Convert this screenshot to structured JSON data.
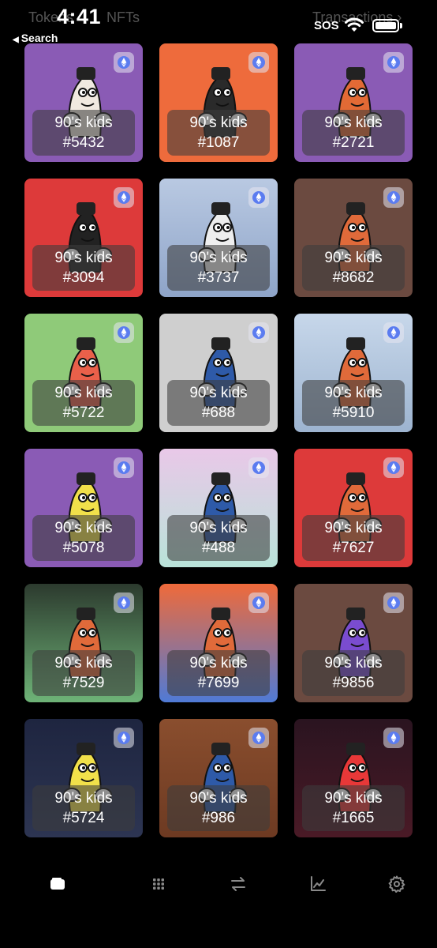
{
  "status_bar": {
    "time": "4:41",
    "back_label": "Search",
    "cellular": "SOS"
  },
  "header": {
    "segments": [
      "Tokens",
      "NFTs"
    ],
    "transactions_label": "Transactions"
  },
  "accent_colors": {
    "purple": "#8b5bb3",
    "orange": "#ee6b3c",
    "red": "#e03c3c",
    "brown": "#6b4a40",
    "green": "#8fca79",
    "gray": "#c9c9c9"
  },
  "nfts": [
    {
      "collection": "90's kids",
      "token": "#5432",
      "bg": "#8a5bb5",
      "bg2": "#8a5bb5",
      "ink": "#f0e9e0",
      "chain_icon": "ethereum-icon"
    },
    {
      "collection": "90's kids",
      "token": "#1087",
      "bg": "#ee6b3c",
      "bg2": "#ee6b3c",
      "ink": "#2a2a2a",
      "chain_icon": "ethereum-icon"
    },
    {
      "collection": "90's kids",
      "token": "#2721",
      "bg": "#8a5bb5",
      "bg2": "#8a5bb5",
      "ink": "#e26a35",
      "chain_icon": "ethereum-icon"
    },
    {
      "collection": "90's kids",
      "token": "#3094",
      "bg": "#dd3a3a",
      "bg2": "#dd3a3a",
      "ink": "#222222",
      "chain_icon": "ethereum-icon"
    },
    {
      "collection": "90's kids",
      "token": "#3737",
      "bg": "#b9c9e2",
      "bg2": "#8ea4c8",
      "ink": "#eeeeee",
      "chain_icon": "ethereum-icon"
    },
    {
      "collection": "90's kids",
      "token": "#8682",
      "bg": "#6b4a40",
      "bg2": "#6b4a40",
      "ink": "#e06a3a",
      "chain_icon": "ethereum-icon"
    },
    {
      "collection": "90's kids",
      "token": "#5722",
      "bg": "#8fca79",
      "bg2": "#8fca79",
      "ink": "#e9604a",
      "chain_icon": "ethereum-icon"
    },
    {
      "collection": "90's kids",
      "token": "#688",
      "bg": "#cfcfcf",
      "bg2": "#cfcfcf",
      "ink": "#2e5aa8",
      "chain_icon": "ethereum-icon"
    },
    {
      "collection": "90's kids",
      "token": "#5910",
      "bg": "#c7d7ea",
      "bg2": "#9db4d0",
      "ink": "#e06a3a",
      "chain_icon": "ethereum-icon"
    },
    {
      "collection": "90's kids",
      "token": "#5078",
      "bg": "#8a5bb5",
      "bg2": "#8a5bb5",
      "ink": "#f1e04a",
      "chain_icon": "ethereum-icon"
    },
    {
      "collection": "90's kids",
      "token": "#488",
      "bg": "#e9c8e8",
      "bg2": "#b9e3d9",
      "ink": "#2e5aa8",
      "chain_icon": "ethereum-icon"
    },
    {
      "collection": "90's kids",
      "token": "#7627",
      "bg": "#dd3a3a",
      "bg2": "#dd3a3a",
      "ink": "#e06a3a",
      "chain_icon": "ethereum-icon"
    },
    {
      "collection": "90's kids",
      "token": "#7529",
      "bg": "#2c3a2e",
      "bg2": "#6eb377",
      "ink": "#e06a3a",
      "chain_icon": "ethereum-icon"
    },
    {
      "collection": "90's kids",
      "token": "#7699",
      "bg": "#ef6a3a",
      "bg2": "#4f7ad6",
      "ink": "#e06a3a",
      "chain_icon": "ethereum-icon"
    },
    {
      "collection": "90's kids",
      "token": "#9856",
      "bg": "#6b4a40",
      "bg2": "#6b4a40",
      "ink": "#7a4ccf",
      "chain_icon": "ethereum-icon"
    },
    {
      "collection": "90's kids",
      "token": "#5724",
      "bg": "#1e2540",
      "bg2": "#2d3552",
      "ink": "#f1e04a",
      "chain_icon": "ethereum-icon"
    },
    {
      "collection": "90's kids",
      "token": "#986",
      "bg": "#8a4e2e",
      "bg2": "#6d3a22",
      "ink": "#2e5aa8",
      "chain_icon": "ethereum-icon"
    },
    {
      "collection": "90's kids",
      "token": "#1665",
      "bg": "#2a1420",
      "bg2": "#4a1a26",
      "ink": "#e83838",
      "chain_icon": "ethereum-icon"
    }
  ],
  "tabbar": [
    {
      "name": "wallet-icon",
      "active": true
    },
    {
      "name": "apps-grid-icon",
      "active": false
    },
    {
      "name": "swap-icon",
      "active": false
    },
    {
      "name": "chart-icon",
      "active": false
    },
    {
      "name": "gear-icon",
      "active": false
    }
  ]
}
